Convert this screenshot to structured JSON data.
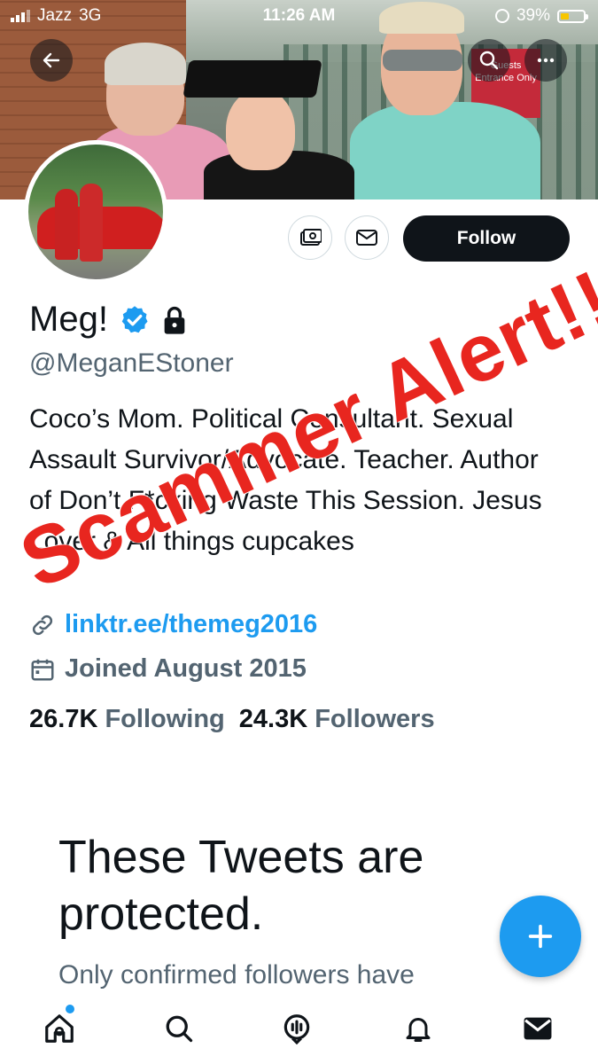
{
  "status_bar": {
    "carrier": "Jazz",
    "network": "3G",
    "time": "11:26 AM",
    "battery": "39%",
    "battery_level": 0.39
  },
  "banner": {
    "sign_text": "Guests Entrance Only"
  },
  "header": {
    "back_icon": "arrow-left-icon",
    "search_icon": "search-icon",
    "more_icon": "more-horizontal-icon"
  },
  "actions": {
    "tip_icon": "tip-jar-icon",
    "message_icon": "envelope-icon",
    "follow_label": "Follow"
  },
  "profile": {
    "display_name": "Meg!",
    "verified": true,
    "protected": true,
    "handle": "@MeganEStoner",
    "bio": "Coco’s Mom. Political Consultant. Sexual Assault Survivor/Advocate. Teacher. Author of Don’t F*cking Waste This Session. Jesus Lover & All things cupcakes",
    "link": "linktr.ee/themeg2016",
    "joined": "Joined August 2015",
    "following_count": "26.7K",
    "following_label": "Following",
    "followers_count": "24.3K",
    "followers_label": "Followers"
  },
  "protected_notice": {
    "title": "These Tweets are protected.",
    "subtitle": "Only confirmed followers have"
  },
  "overlay": {
    "stamp_text": "Scammer Alert!!!!!",
    "color": "#e8261f"
  },
  "colors": {
    "accent": "#1d9bf0",
    "text_primary": "#0f1419",
    "text_secondary": "#536471"
  },
  "bottom_nav": {
    "items": [
      "home-icon",
      "search-icon",
      "spaces-icon",
      "notifications-icon",
      "messages-icon"
    ]
  }
}
